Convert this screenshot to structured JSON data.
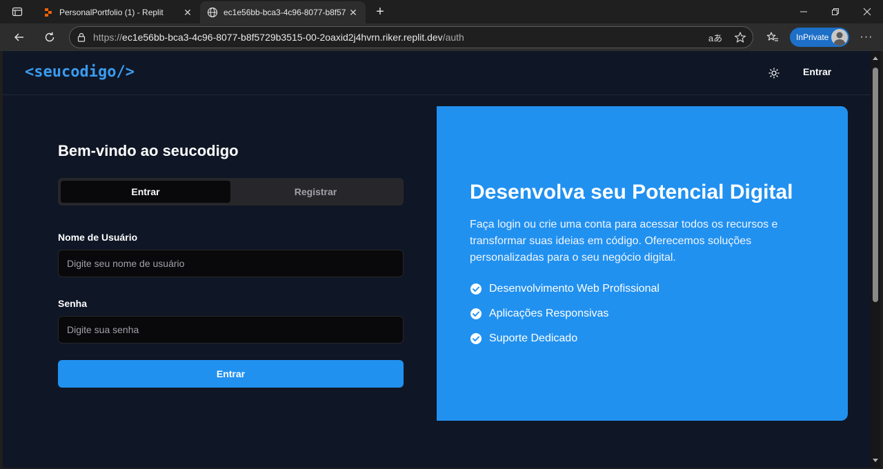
{
  "browser": {
    "tabs": [
      {
        "title": "PersonalPortfolio (1) - Replit",
        "active": false
      },
      {
        "title": "ec1e56bb-bca3-4c96-8077-b8f57",
        "active": true
      }
    ],
    "url_prefix": "https://",
    "url_host": "ec1e56bb-bca3-4c96-8077-b8f5729b3515-00-2oaxid2j4hvrn.riker.replit.dev",
    "url_path": "/auth",
    "inprivate_label": "InPrivate",
    "read_aloud_label": "aあ"
  },
  "site": {
    "logo": "<seucodigo/>",
    "header_login": "Entrar"
  },
  "form": {
    "title": "Bem-vindo ao seucodigo",
    "tab_login": "Entrar",
    "tab_register": "Registrar",
    "username_label": "Nome de Usuário",
    "username_placeholder": "Digite seu nome de usuário",
    "password_label": "Senha",
    "password_placeholder": "Digite sua senha",
    "submit_label": "Entrar"
  },
  "hero": {
    "title": "Desenvolva seu Potencial Digital",
    "description": "Faça login ou crie uma conta para acessar todos os recursos e transformar suas ideias em código. Oferecemos soluções personalizadas para o seu negócio digital.",
    "features": [
      "Desenvolvimento Web Profissional",
      "Aplicações Responsivas",
      "Suporte Dedicado"
    ]
  },
  "colors": {
    "accent": "#2191f0",
    "background": "#0f1625",
    "logo": "#3a9cf0"
  }
}
